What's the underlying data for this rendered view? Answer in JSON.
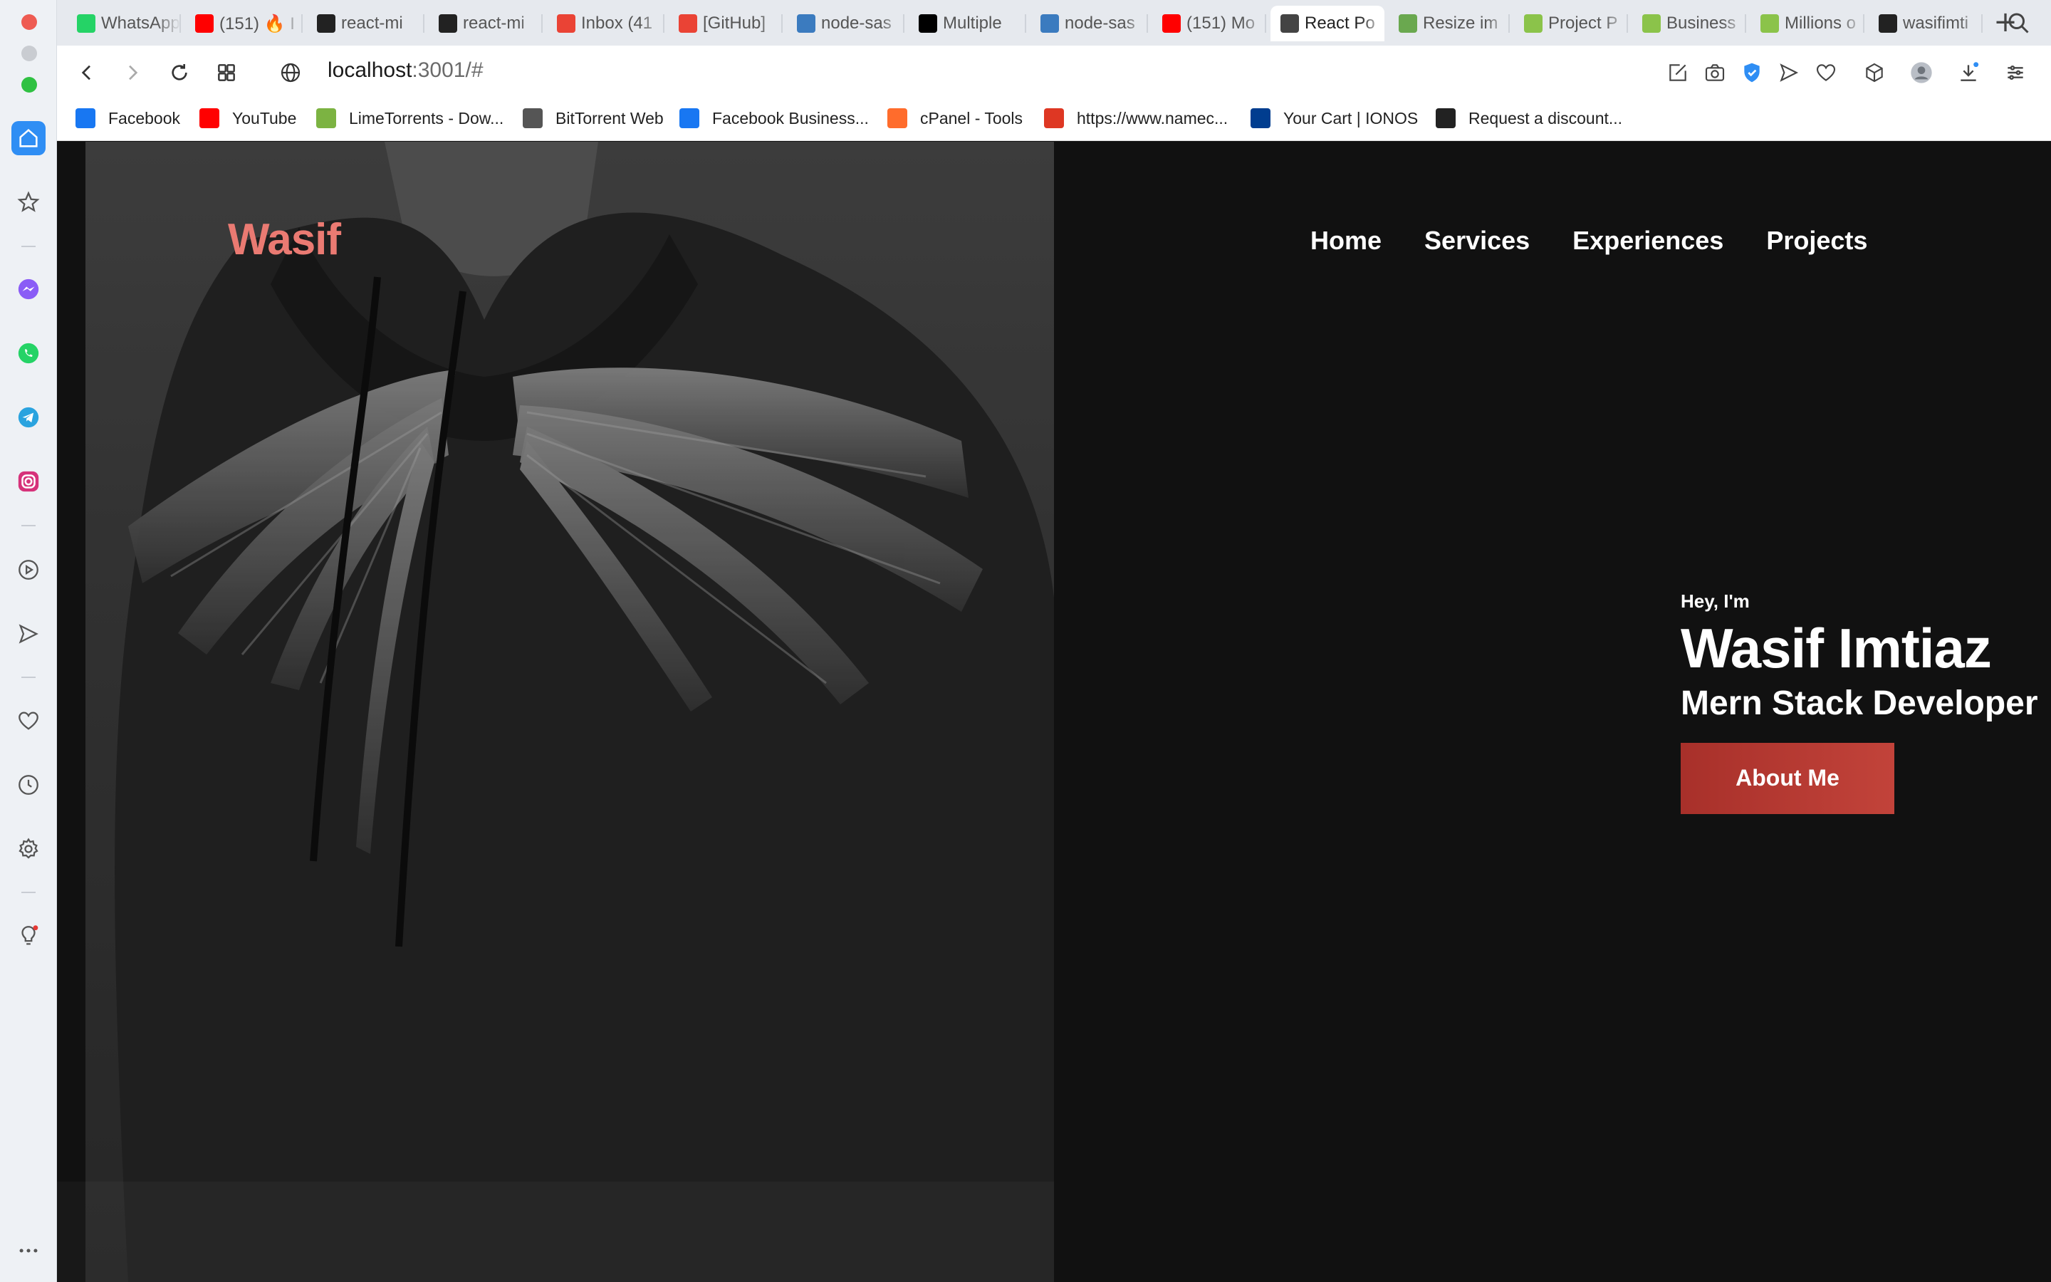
{
  "browser": {
    "tabs": [
      {
        "label": "WhatsApp",
        "icon": "whatsapp-icon",
        "color": "#25d366"
      },
      {
        "label": "(151) 🔥 I",
        "icon": "youtube-icon",
        "color": "#ff0000"
      },
      {
        "label": "react-mi",
        "icon": "github-icon",
        "color": "#222222"
      },
      {
        "label": "react-mi",
        "icon": "github-icon",
        "color": "#222222"
      },
      {
        "label": "Inbox (41",
        "icon": "gmail-icon",
        "color": "#ea4335"
      },
      {
        "label": "[GitHub]",
        "icon": "gmail-icon",
        "color": "#ea4335"
      },
      {
        "label": "node-sas",
        "icon": "stackoverflow-icon",
        "color": "#3b7bbf"
      },
      {
        "label": "Multiple",
        "icon": "dev-icon",
        "color": "#000000"
      },
      {
        "label": "node-sas",
        "icon": "stackoverflow-icon",
        "color": "#3b7bbf"
      },
      {
        "label": "(151) Mo",
        "icon": "youtube-icon",
        "color": "#ff0000"
      },
      {
        "label": "React Po",
        "icon": "globe-icon",
        "color": "#444444",
        "active": true
      },
      {
        "label": "Resize im",
        "icon": "resize-icon",
        "color": "#6aa84f"
      },
      {
        "label": "Project P",
        "icon": "p-icon",
        "color": "#8bc34a"
      },
      {
        "label": "Business",
        "icon": "p-icon",
        "color": "#8bc34a"
      },
      {
        "label": "Millions o",
        "icon": "p-icon",
        "color": "#8bc34a"
      },
      {
        "label": "wasifimti",
        "icon": "github-icon",
        "color": "#222222"
      }
    ],
    "url": {
      "host": "localhost",
      "path": ":3001/#"
    },
    "bookmarks": [
      {
        "label": "Facebook",
        "icon": "facebook-icon",
        "color": "#1877f2"
      },
      {
        "label": "YouTube",
        "icon": "youtube-icon",
        "color": "#ff0000"
      },
      {
        "label": "LimeTorrents - Dow...",
        "icon": "limetorrents-icon",
        "color": "#7cb342"
      },
      {
        "label": "BitTorrent Web",
        "icon": "file-icon",
        "color": "#555555"
      },
      {
        "label": "Facebook Business...",
        "icon": "meta-icon",
        "color": "#1877f2"
      },
      {
        "label": "cPanel - Tools",
        "icon": "cpanel-icon",
        "color": "#ff6c2c"
      },
      {
        "label": "https://www.namec...",
        "icon": "namecheap-icon",
        "color": "#de3723"
      },
      {
        "label": "Your Cart | IONOS",
        "icon": "ionos-icon",
        "color": "#003d8f"
      },
      {
        "label": "Request a discount...",
        "icon": "github-icon",
        "color": "#222222"
      }
    ]
  },
  "site": {
    "logo": "Wasif",
    "nav": [
      "Home",
      "Services",
      "Experiences",
      "Projects"
    ],
    "hero": {
      "greeting": "Hey, I'm",
      "name": "Wasif Imtiaz",
      "role": "Mern Stack Developer",
      "cta": "About Me"
    },
    "colors": {
      "logo": "#ea7a72",
      "cta": "#b83a32",
      "background": "#111111"
    }
  }
}
